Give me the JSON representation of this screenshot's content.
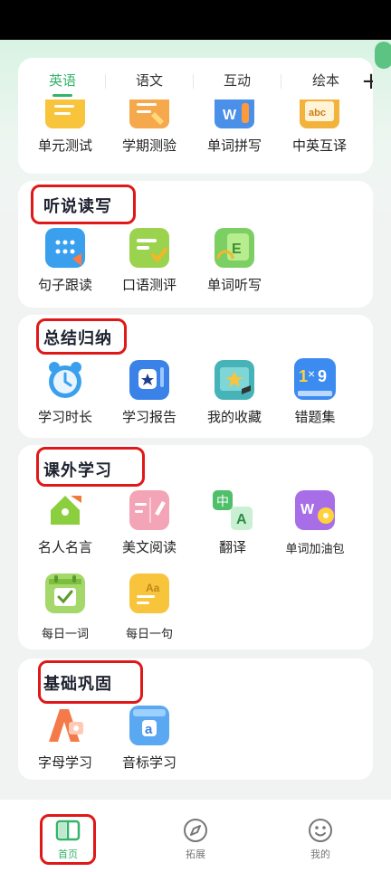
{
  "tabs": [
    {
      "label": "英语",
      "active": true
    },
    {
      "label": "语文"
    },
    {
      "label": "互动"
    },
    {
      "label": "绘本"
    }
  ],
  "add_tab": "+",
  "top_items": [
    {
      "label": "单元测试",
      "icon": "unit-test-icon"
    },
    {
      "label": "学期测验",
      "icon": "semester-quiz-icon"
    },
    {
      "label": "单词拼写",
      "icon": "word-spelling-icon"
    },
    {
      "label": "中英互译",
      "icon": "translate-book-icon"
    }
  ],
  "sections": {
    "listen": {
      "title": "听说读写",
      "items": [
        {
          "label": "句子跟读",
          "icon": "sentence-read-icon"
        },
        {
          "label": "口语测评",
          "icon": "oral-test-icon"
        },
        {
          "label": "单词听写",
          "icon": "word-dictation-icon"
        }
      ]
    },
    "summary": {
      "title": "总结归纳",
      "items": [
        {
          "label": "学习时长",
          "icon": "clock-icon"
        },
        {
          "label": "学习报告",
          "icon": "report-icon"
        },
        {
          "label": "我的收藏",
          "icon": "collection-icon"
        },
        {
          "label": "错题集",
          "icon": "wrong-answers-icon"
        }
      ]
    },
    "extra": {
      "title": "课外学习",
      "items": [
        {
          "label": "名人名言",
          "icon": "quote-icon"
        },
        {
          "label": "美文阅读",
          "icon": "reading-icon"
        },
        {
          "label": "翻译",
          "icon": "translate-icon"
        },
        {
          "label": "单词加油包",
          "icon": "word-pack-icon"
        },
        {
          "label": "每日一词",
          "icon": "daily-word-icon"
        },
        {
          "label": "每日一句",
          "icon": "daily-sentence-icon"
        }
      ]
    },
    "basic": {
      "title": "基础巩固",
      "items": [
        {
          "label": "字母学习",
          "icon": "alphabet-icon"
        },
        {
          "label": "音标学习",
          "icon": "phonetic-icon"
        }
      ]
    }
  },
  "nav": [
    {
      "label": "首页",
      "icon": "book-icon",
      "active": true
    },
    {
      "label": "拓展",
      "icon": "compass-icon"
    },
    {
      "label": "我的",
      "icon": "smile-icon"
    }
  ],
  "colors": {
    "accent": "#36b36b",
    "highlight": "#e01818"
  }
}
